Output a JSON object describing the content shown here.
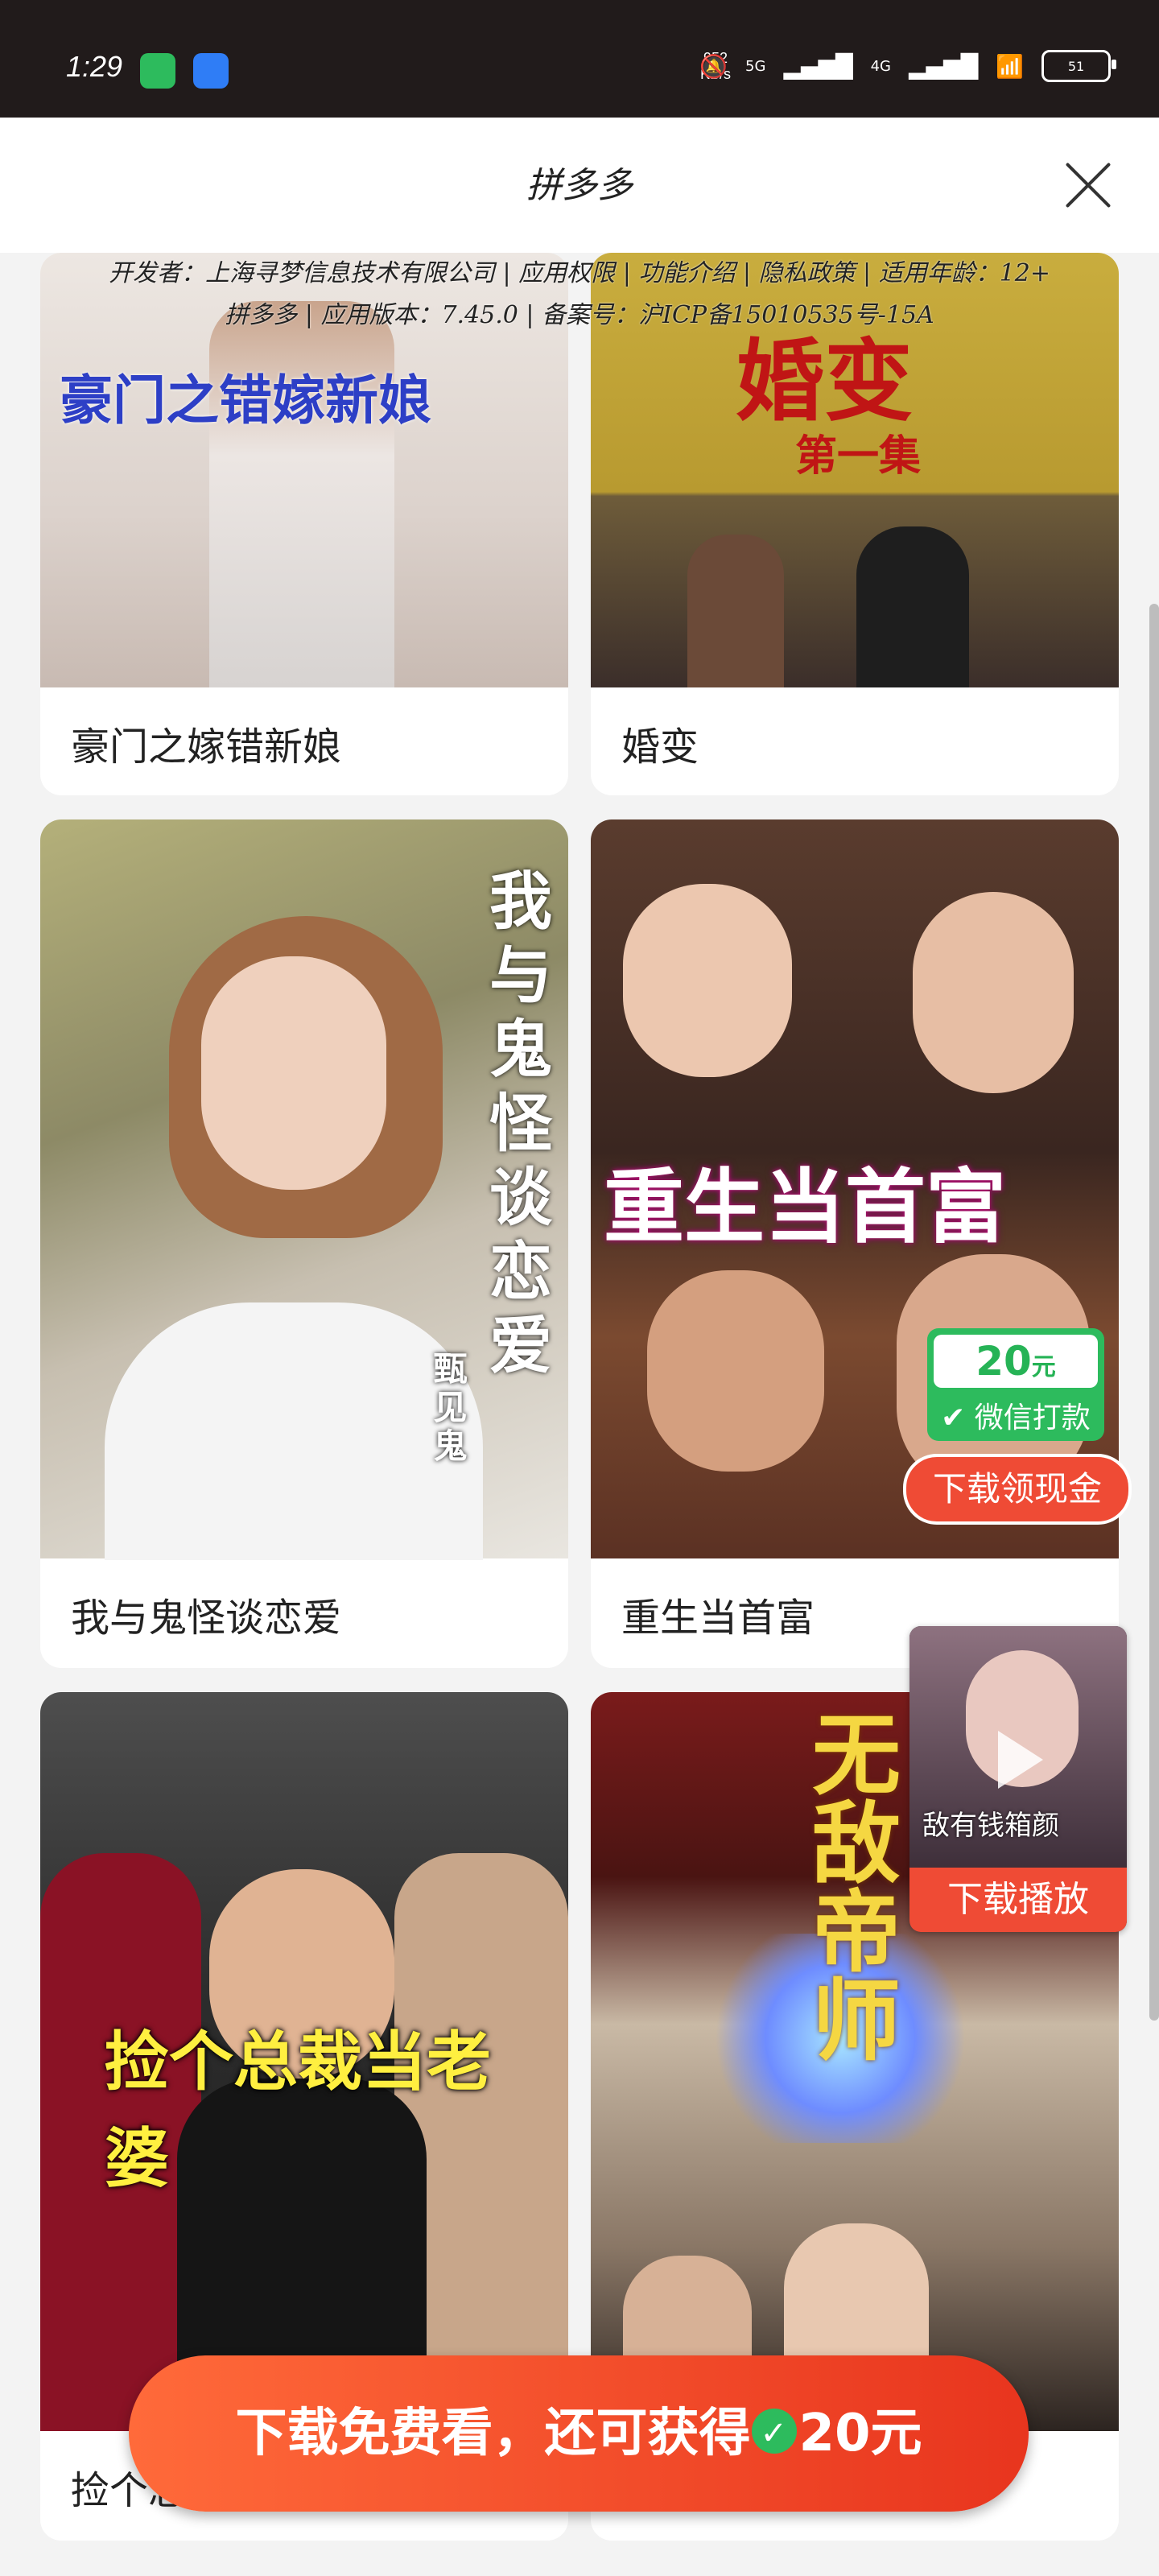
{
  "status_bar": {
    "time": "1:29",
    "speed": "952\nKB/s",
    "net_5g": "5G",
    "net_4g": "4G",
    "battery": "51"
  },
  "header": {
    "title": "拼多多",
    "close_icon": "close-icon"
  },
  "info": {
    "line1": "开发者：上海寻梦信息技术有限公司 | 应用权限 | 功能介绍 | 隐私政策 | 适用年龄：12+",
    "line2": "拼多多 | 应用版本：7.45.0 | 备案号：沪ICP备15010535号-15A"
  },
  "cards": [
    {
      "poster_title": "豪门之错嫁新娘",
      "name": "豪门之嫁错新娘"
    },
    {
      "poster_title": "婚变",
      "poster_sub": "第一集",
      "name": "婚变"
    },
    {
      "poster_title": "我与鬼怪谈恋爱",
      "poster_sub": "甄见鬼",
      "name": "我与鬼怪谈恋爱"
    },
    {
      "poster_title": "重生当首富",
      "name": "重生当首富"
    },
    {
      "poster_title": "捡个总裁当老婆",
      "name": "捡个总"
    },
    {
      "poster_title": "无敌帝师",
      "name": ""
    }
  ],
  "promo_badge": {
    "amount": "20",
    "unit": "元",
    "label": "微信打款"
  },
  "download_cash": "下载领现金",
  "float_video": {
    "button": "下载播放",
    "caption": "敌有钱箱颜"
  },
  "bottom_cta": {
    "text_before": "下载免费看，还可获得",
    "text_after": "20元"
  },
  "colors": {
    "accent": "#ef4b35",
    "wechat": "#2dbb5d"
  }
}
